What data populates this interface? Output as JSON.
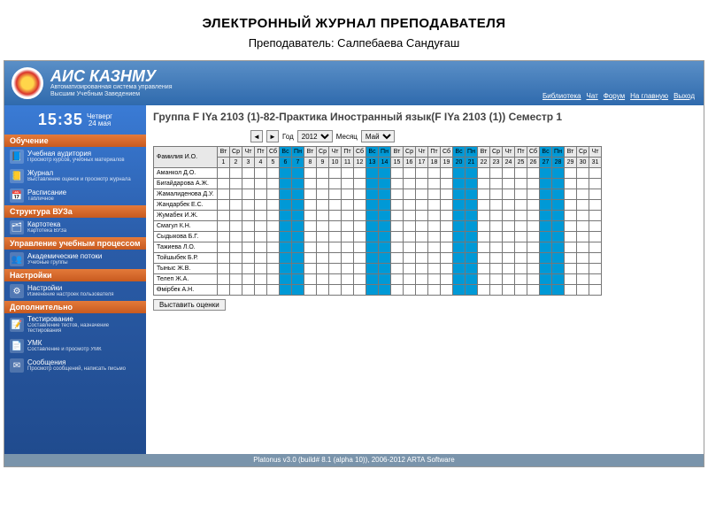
{
  "slide": {
    "title": "ЭЛЕКТРОННЫЙ ЖУРНАЛ ПРЕПОДАВАТЕЛЯ",
    "subtitle": "Преподаватель: Салпебаева Сандуғаш"
  },
  "brand": {
    "title": "АИС КАЗНМУ",
    "sub1": "Автоматизированная система управления",
    "sub2": "Высшим Учебным Заведением"
  },
  "toplinks": [
    "Библиотека",
    "Чат",
    "Форум",
    "На главную",
    "Выход"
  ],
  "clock": {
    "time": "15:35",
    "weekday": "Четверг",
    "date": "24 мая"
  },
  "sidebar": {
    "sections": [
      {
        "title": "Обучение",
        "style": "orange",
        "items": [
          {
            "label": "Учебная аудитория",
            "desc": "Просмотр курсов, учебных материалов",
            "icon": "📘"
          },
          {
            "label": "Журнал",
            "desc": "Выставление оценок и просмотр журнала",
            "icon": "📒"
          },
          {
            "label": "Расписание",
            "desc": "Табличное",
            "icon": "📅"
          }
        ]
      },
      {
        "title": "Структура ВУЗа",
        "style": "orange",
        "items": [
          {
            "label": "Картотека",
            "desc": "Картотека ВУЗа",
            "icon": "🗂"
          }
        ]
      },
      {
        "title": "Управление учебным процессом",
        "style": "orange",
        "items": [
          {
            "label": "Академические потоки",
            "desc": "Учебные группы",
            "icon": "👥"
          }
        ]
      },
      {
        "title": "Настройки",
        "style": "orange",
        "items": [
          {
            "label": "Настройки",
            "desc": "Изменение настроек пользователя",
            "icon": "⚙"
          }
        ]
      },
      {
        "title": "Дополнительно",
        "style": "orange",
        "items": [
          {
            "label": "Тестирование",
            "desc": "Составление тестов, назначение тестирования",
            "icon": "📝"
          },
          {
            "label": "УМК",
            "desc": "Составление и просмотр УМК",
            "icon": "📄"
          },
          {
            "label": "Сообщения",
            "desc": "Просмотр сообщений, написать письмо",
            "icon": "✉"
          }
        ]
      }
    ]
  },
  "main": {
    "group_title": "Группа F IYa 2103 (1)-82-Практика Иностранный язык(F IYa 2103 (1)) Семестр 1",
    "year_label": "Год",
    "year_value": "2012",
    "month_label": "Месяц",
    "month_value": "Май",
    "name_header": "Фамилия И.О.",
    "weekdays": [
      "Вт",
      "Ср",
      "Чт",
      "Пт",
      "Сб",
      "Вс",
      "Пн",
      "Вт",
      "Ср",
      "Чт",
      "Пт",
      "Сб",
      "Вс",
      "Пн",
      "Вт",
      "Ср",
      "Чт",
      "Пт",
      "Сб",
      "Вс",
      "Пн",
      "Вт",
      "Ср",
      "Чт",
      "Пт",
      "Сб",
      "Вс",
      "Пн",
      "Вт",
      "Ср",
      "Чт"
    ],
    "days": [
      "1",
      "2",
      "3",
      "4",
      "5",
      "6",
      "7",
      "8",
      "9",
      "10",
      "11",
      "12",
      "13",
      "14",
      "15",
      "16",
      "17",
      "18",
      "19",
      "20",
      "21",
      "22",
      "23",
      "24",
      "25",
      "26",
      "27",
      "28",
      "29",
      "30",
      "31"
    ],
    "highlight_cols": [
      6,
      7,
      13,
      14,
      20,
      21,
      27,
      28
    ],
    "students": [
      "Аманкол Д.О.",
      "Бигайдарова А.Ж.",
      "Жамалиденова Д.У.",
      "Жандарбек Е.С.",
      "Жумабек И.Ж.",
      "Смагул К.Н.",
      "Сыдыкова Б.Г.",
      "Тажиева Л.О.",
      "Тойшыбек Б.Р.",
      "Тыныс Ж.В.",
      "Телеп Ж.А.",
      "Өмірбек А.Н."
    ],
    "submit_label": "Выставить оценки"
  },
  "footer": "Platonus v3.0 (build# 8.1 (alpha 10)), 2006-2012 ARTA Software"
}
